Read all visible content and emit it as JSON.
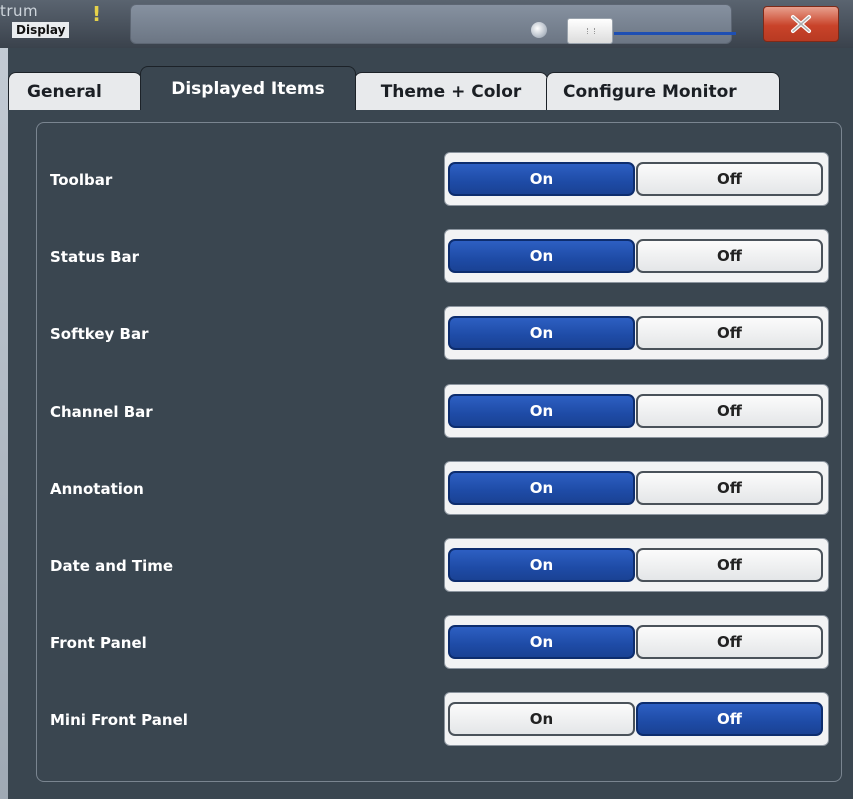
{
  "window": {
    "app_title_fragment": "trum",
    "dialog_title": "Display",
    "warning_glyph": "!",
    "close_label": "X",
    "warn_color": "#e6d24a",
    "close_color": "#c9432a"
  },
  "tabs": [
    {
      "label": "General",
      "active": false
    },
    {
      "label": "Displayed Items",
      "active": true
    },
    {
      "label": "Theme + Color",
      "active": false
    },
    {
      "label": "Configure Monitor",
      "active": false
    }
  ],
  "items": [
    {
      "label": "Toolbar",
      "on_label": "On",
      "off_label": "Off",
      "value": "On"
    },
    {
      "label": "Status Bar",
      "on_label": "On",
      "off_label": "Off",
      "value": "On"
    },
    {
      "label": "Softkey Bar",
      "on_label": "On",
      "off_label": "Off",
      "value": "On"
    },
    {
      "label": "Channel Bar",
      "on_label": "On",
      "off_label": "Off",
      "value": "On"
    },
    {
      "label": "Annotation",
      "on_label": "On",
      "off_label": "Off",
      "value": "On"
    },
    {
      "label": "Date and Time",
      "on_label": "On",
      "off_label": "Off",
      "value": "On"
    },
    {
      "label": "Front Panel",
      "on_label": "On",
      "off_label": "Off",
      "value": "On"
    },
    {
      "label": "Mini Front Panel",
      "on_label": "On",
      "off_label": "Off",
      "value": "Off"
    }
  ],
  "colors": {
    "selected": "#1e4ba6",
    "dialog_bg": "#3a4650"
  }
}
